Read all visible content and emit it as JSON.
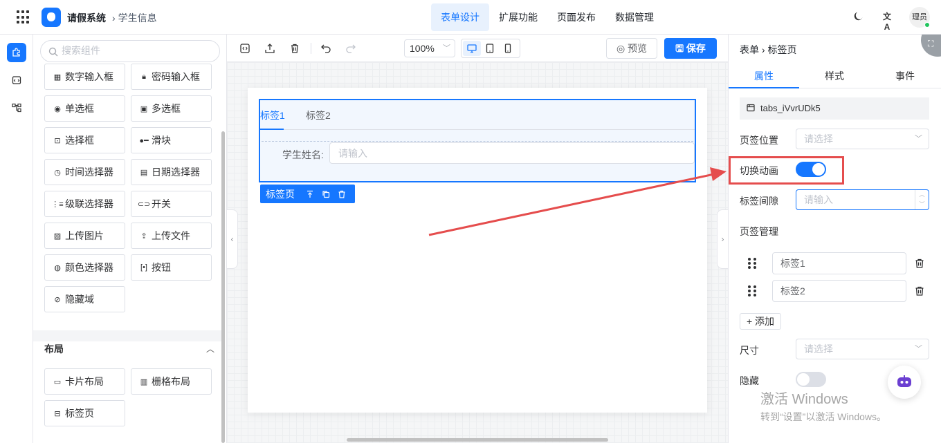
{
  "header": {
    "app_title": "请假系统",
    "breadcrumb": "学生信息",
    "nav": [
      "表单设计",
      "扩展功能",
      "页面发布",
      "数据管理"
    ],
    "active_nav": "表单设计",
    "translate_icon_text": "文A",
    "user": "理员"
  },
  "components": {
    "search_placeholder": "搜索组件",
    "items": [
      {
        "label": "数字输入框",
        "icon": "number-input-icon"
      },
      {
        "label": "密码输入框",
        "icon": "lock-icon"
      },
      {
        "label": "单选框",
        "icon": "radio-icon"
      },
      {
        "label": "多选框",
        "icon": "checkbox-icon"
      },
      {
        "label": "选择框",
        "icon": "select-icon"
      },
      {
        "label": "滑块",
        "icon": "slider-icon"
      },
      {
        "label": "时间选择器",
        "icon": "clock-icon"
      },
      {
        "label": "日期选择器",
        "icon": "calendar-icon"
      },
      {
        "label": "级联选择器",
        "icon": "cascader-icon"
      },
      {
        "label": "开关",
        "icon": "switch-icon"
      },
      {
        "label": "上传图片",
        "icon": "image-icon"
      },
      {
        "label": "上传文件",
        "icon": "upload-icon"
      },
      {
        "label": "颜色选择器",
        "icon": "palette-icon"
      },
      {
        "label": "按钮",
        "icon": "button-icon"
      },
      {
        "label": "隐藏域",
        "icon": "eye-off-icon"
      }
    ],
    "layout_section": {
      "title": "布局",
      "items": [
        {
          "label": "卡片布局",
          "icon": "card-icon"
        },
        {
          "label": "栅格布局",
          "icon": "grid-layout-icon"
        },
        {
          "label": "标签页",
          "icon": "tabs-icon"
        }
      ]
    }
  },
  "toolbar": {
    "zoom": "100%",
    "preview_label": "预览",
    "save_label": "保存"
  },
  "canvas": {
    "tabs": [
      "标签1",
      "标签2"
    ],
    "active_tab": "标签1",
    "field_label": "学生姓名:",
    "field_placeholder": "请输入",
    "widget_tag": "标签页"
  },
  "properties": {
    "breadcrumb": [
      "表单",
      "标签页"
    ],
    "tabs": [
      "属性",
      "样式",
      "事件"
    ],
    "active_tab": "属性",
    "component_id": "tabs_iVvrUDk5",
    "tab_position_label": "页签位置",
    "tab_position_placeholder": "请选择",
    "animation_label": "切换动画",
    "animation_on": true,
    "gap_label": "标签间隙",
    "gap_placeholder": "请输入",
    "manage_label": "页签管理",
    "tab_items": [
      "标签1",
      "标签2"
    ],
    "add_label": "+ 添加",
    "size_label": "尺寸",
    "size_placeholder": "请选择",
    "hidden_label": "隐藏",
    "hidden_on": false
  },
  "watermark": {
    "line1": "激活 Windows",
    "line2": "转到“设置”以激活 Windows。"
  },
  "colors": {
    "primary": "#1677ff",
    "annotation": "#e54d4d"
  }
}
